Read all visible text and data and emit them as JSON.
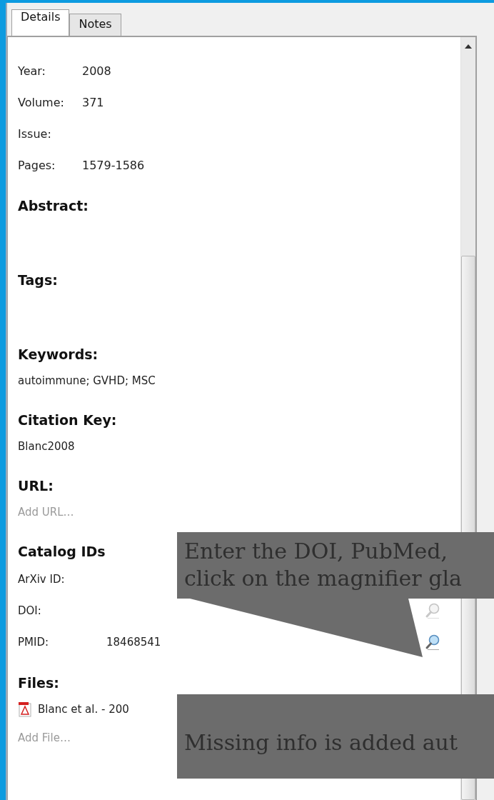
{
  "tabs": [
    {
      "label": "Details",
      "selected": true
    },
    {
      "label": "Notes",
      "selected": false
    }
  ],
  "fields": [
    {
      "label": "Year:",
      "value": "2008"
    },
    {
      "label": "Volume:",
      "value": "371"
    },
    {
      "label": "Issue:"
    },
    {
      "label": "Pages:",
      "value": "1579-1586"
    }
  ],
  "sections": [
    {
      "heading": "Abstract:",
      "kind": "empty"
    },
    {
      "heading": "Tags:",
      "kind": "empty"
    },
    {
      "heading": "Keywords:",
      "kind": "text",
      "value": "autoimmune; GVHD; MSC"
    },
    {
      "heading": "Citation Key:",
      "kind": "text",
      "value": "Blanc2008"
    },
    {
      "heading": "URL:",
      "kind": "add",
      "placeholder": "Add URL…"
    },
    {
      "heading": "Catalog IDs",
      "kind": "ids",
      "ids": [
        {
          "label": "ArXiv ID:"
        },
        {
          "label": "DOI:",
          "lookup_enabled": false
        },
        {
          "label": "PMID:",
          "value": "18468541",
          "lookup_enabled": true
        }
      ]
    },
    {
      "heading": "Files:",
      "kind": "files",
      "files": [
        "Blanc et al. - 200"
      ],
      "placeholder": "Add File…"
    }
  ],
  "callouts": [
    {
      "lines": [
        "Enter the DOI, PubMed,",
        "click on the magnifier gla"
      ],
      "pointer": true
    },
    {
      "lines": [
        "Missing info is added aut"
      ],
      "pointer": false
    }
  ]
}
